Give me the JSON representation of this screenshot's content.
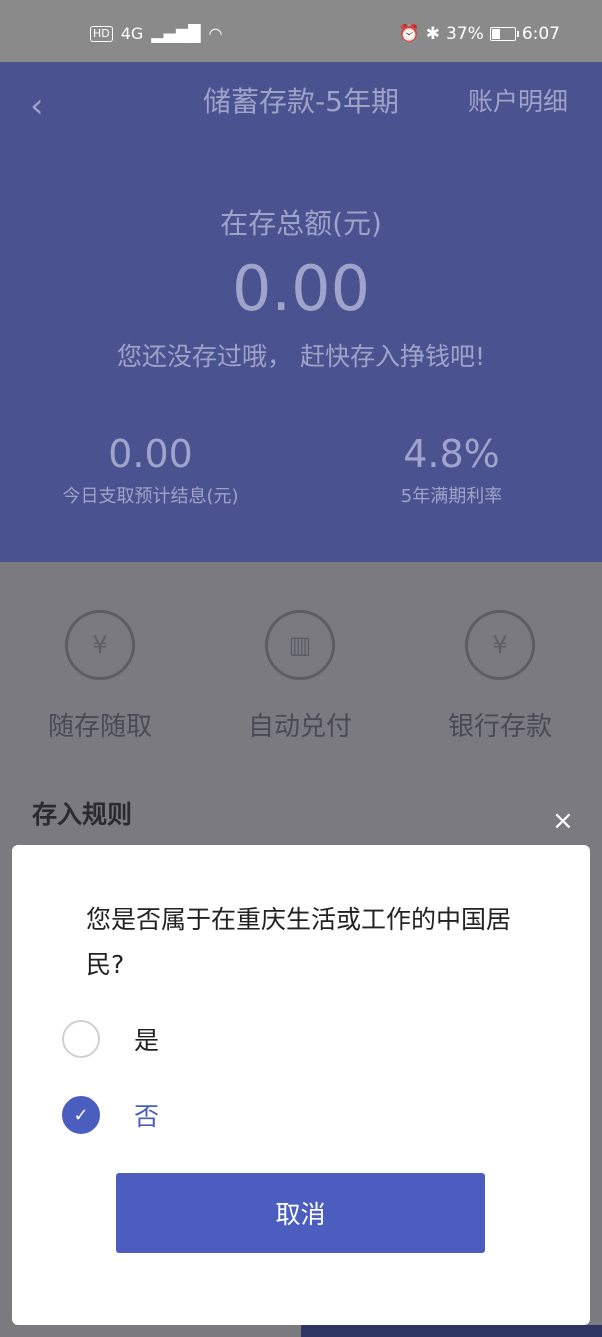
{
  "status_bar": {
    "hd": "HD",
    "network": "4G",
    "battery": "37%",
    "time": "6:07",
    "battery_level": 0.37
  },
  "header": {
    "title": "储蓄存款-5年期",
    "account_detail": "账户明细",
    "total_label": "在存总额(元)",
    "total_amount": "0.00",
    "hint": "您还没存过哦， 赶快存入挣钱吧!",
    "stats": [
      {
        "value": "0.00",
        "label": "今日支取预计结息(元)"
      },
      {
        "value": "4.8%",
        "label": "5年满期利率"
      }
    ]
  },
  "features": [
    {
      "label": "随存随取",
      "icon": "deposit-withdraw-icon"
    },
    {
      "label": "自动兑付",
      "icon": "auto-pay-icon"
    },
    {
      "label": "银行存款",
      "icon": "bank-deposit-shield-icon"
    }
  ],
  "rules": {
    "title": "存入规则"
  },
  "dialog": {
    "question": "您是否属于在重庆生活或工作的中国居民?",
    "options": [
      {
        "label": "是",
        "selected": false
      },
      {
        "label": "否",
        "selected": true
      }
    ],
    "cancel": "取消",
    "close": "×"
  },
  "colors": {
    "header": "#4b5290",
    "primary": "#4b5ec0"
  }
}
